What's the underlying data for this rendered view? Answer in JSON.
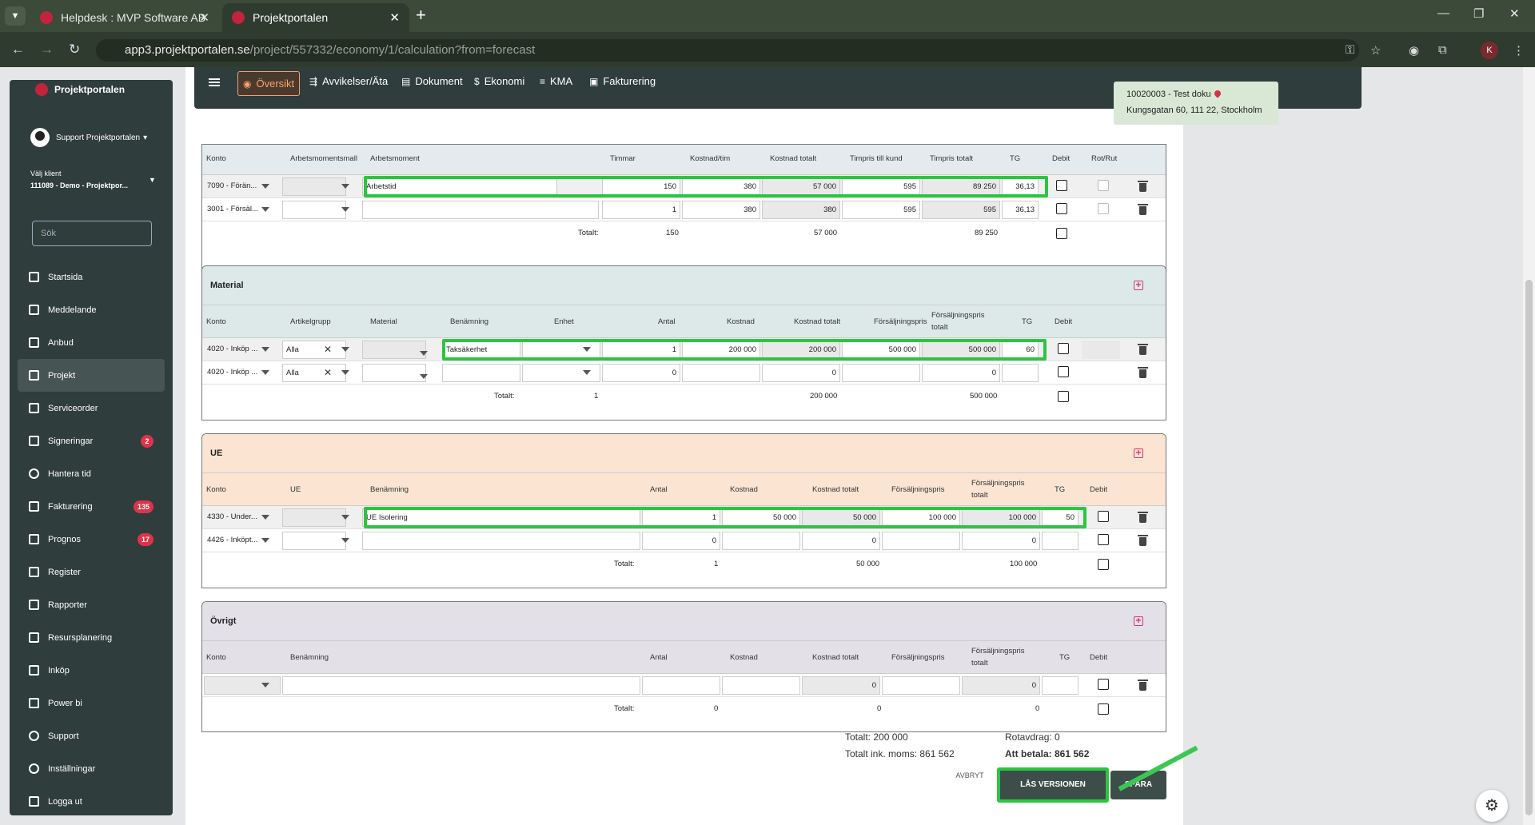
{
  "browser": {
    "tabs": [
      {
        "title": "Helpdesk : MVP Software AB"
      },
      {
        "title": "Projektportalen"
      }
    ],
    "url_host": "app3.projektportalen.se",
    "url_path": "/project/557332/economy/1/calculation?from=forecast",
    "profile_initial": "K"
  },
  "sidebar": {
    "brand": "Projektportalen",
    "user": "Support Projektportalen",
    "client_label": "Välj klient",
    "client_value": "111089 - Demo - Projektpor...",
    "search_placeholder": "Sök",
    "items": [
      {
        "label": "Startsida",
        "badge": ""
      },
      {
        "label": "Meddelande",
        "badge": ""
      },
      {
        "label": "Anbud",
        "badge": ""
      },
      {
        "label": "Projekt",
        "badge": ""
      },
      {
        "label": "Serviceorder",
        "badge": ""
      },
      {
        "label": "Signeringar",
        "badge": "2"
      },
      {
        "label": "Hantera tid",
        "badge": ""
      },
      {
        "label": "Fakturering",
        "badge": "135"
      },
      {
        "label": "Prognos",
        "badge": "17"
      },
      {
        "label": "Register",
        "badge": ""
      },
      {
        "label": "Rapporter",
        "badge": ""
      },
      {
        "label": "Resursplanering",
        "badge": ""
      },
      {
        "label": "Inköp",
        "badge": ""
      },
      {
        "label": "Power bi",
        "badge": ""
      },
      {
        "label": "Support",
        "badge": ""
      },
      {
        "label": "Inställningar",
        "badge": ""
      },
      {
        "label": "Logga ut",
        "badge": ""
      }
    ]
  },
  "topnav": {
    "items": [
      "Översikt",
      "Avvikelser/Äta",
      "Dokument",
      "Ekonomi",
      "KMA",
      "Fakturering"
    ]
  },
  "project_card": {
    "line1": "10020003 - Test doku",
    "line2": "Kungsgatan 60, 111 22, Stockholm"
  },
  "work": {
    "headers": [
      "Konto",
      "Arbetsmomentsmall",
      "Arbetsmoment",
      "Timmar",
      "Kostnad/tim",
      "Kostnad totalt",
      "Timpris till kund",
      "Timpris totalt",
      "TG",
      "Debit",
      "Rot/Rut"
    ],
    "rows": [
      {
        "konto": "7090 - Förän...",
        "moment": "Arbetstid",
        "timmar": "150",
        "kostnad": "380",
        "kostnad_totalt": "57 000",
        "timpris": "595",
        "timpris_totalt": "89 250",
        "tg": "36,13"
      },
      {
        "konto": "3001 - Försäl...",
        "moment": "",
        "timmar": "1",
        "kostnad": "380",
        "kostnad_totalt": "380",
        "timpris": "595",
        "timpris_totalt": "595",
        "tg": "36,13"
      }
    ],
    "total_label": "Totalt:",
    "total_timmar": "150",
    "total_kostnad": "57 000",
    "total_timpris": "89 250"
  },
  "material": {
    "title": "Material",
    "headers": [
      "Konto",
      "Artikelgrupp",
      "Material",
      "Benämning",
      "Enhet",
      "Antal",
      "Kostnad",
      "Kostnad totalt",
      "Försäljningspris",
      "Försäljningspris",
      "totalt",
      "TG",
      "Debit"
    ],
    "rows": [
      {
        "konto": "4020 - Inköp ...",
        "grupp": "Alla",
        "benamning": "Taksäkerhet",
        "antal": "1",
        "kostnad": "200 000",
        "kostnad_totalt": "200 000",
        "pris": "500 000",
        "pris_totalt": "500 000",
        "tg": "60"
      },
      {
        "konto": "4020 - Inköp ...",
        "grupp": "Alla",
        "benamning": "",
        "antal": "0",
        "kostnad": "",
        "kostnad_totalt": "0",
        "pris": "",
        "pris_totalt": "0",
        "tg": ""
      }
    ],
    "total_label": "Totalt:",
    "total_antal": "1",
    "total_kostnad": "200 000",
    "total_pris": "500 000"
  },
  "ue": {
    "title": "UE",
    "headers": [
      "Konto",
      "UE",
      "Benämning",
      "Antal",
      "Kostnad",
      "Kostnad totalt",
      "Försäljningspris",
      "Försäljningspris",
      "totalt",
      "TG",
      "Debit"
    ],
    "rows": [
      {
        "konto": "4330 - Under...",
        "benamning": "UE Isolering",
        "antal": "1",
        "kostnad": "50 000",
        "kostnad_totalt": "50 000",
        "pris": "100 000",
        "pris_totalt": "100 000",
        "tg": "50"
      },
      {
        "konto": "4426 - Inköpt...",
        "benamning": "",
        "antal": "0",
        "kostnad": "",
        "kostnad_totalt": "0",
        "pris": "",
        "pris_totalt": "0",
        "tg": ""
      }
    ],
    "total_label": "Totalt:",
    "total_antal": "1",
    "total_kostnad": "50 000",
    "total_pris": "100 000"
  },
  "ovrigt": {
    "title": "Övrigt",
    "headers": [
      "Konto",
      "Benämning",
      "Antal",
      "Kostnad",
      "Kostnad totalt",
      "Försäljningspris",
      "Försäljningspris",
      "totalt",
      "TG",
      "Debit"
    ],
    "row": {
      "kostnad_totalt": "0",
      "pris_totalt": "0"
    },
    "total_label": "Totalt:",
    "total_antal": "0",
    "total_kostnad": "0",
    "total_pris": "0"
  },
  "summary": {
    "totalt": "Totalt: 200 000",
    "totalt_moms": "Totalt ink. moms: 861 562",
    "rotavdrag": "Rotavdrag: 0",
    "att_betala": "Att betala: 861 562"
  },
  "actions": {
    "cancel": "AVBRYT",
    "lock": "LÅS VERSIONEN",
    "save": "SPARA"
  },
  "colors": {
    "highlight": "#2bc640",
    "sidebar": "#2f3d3c",
    "material_bg": "#dde9e9",
    "ue_bg": "#fbe4d2",
    "ovrigt_bg": "#e4e0e8"
  }
}
